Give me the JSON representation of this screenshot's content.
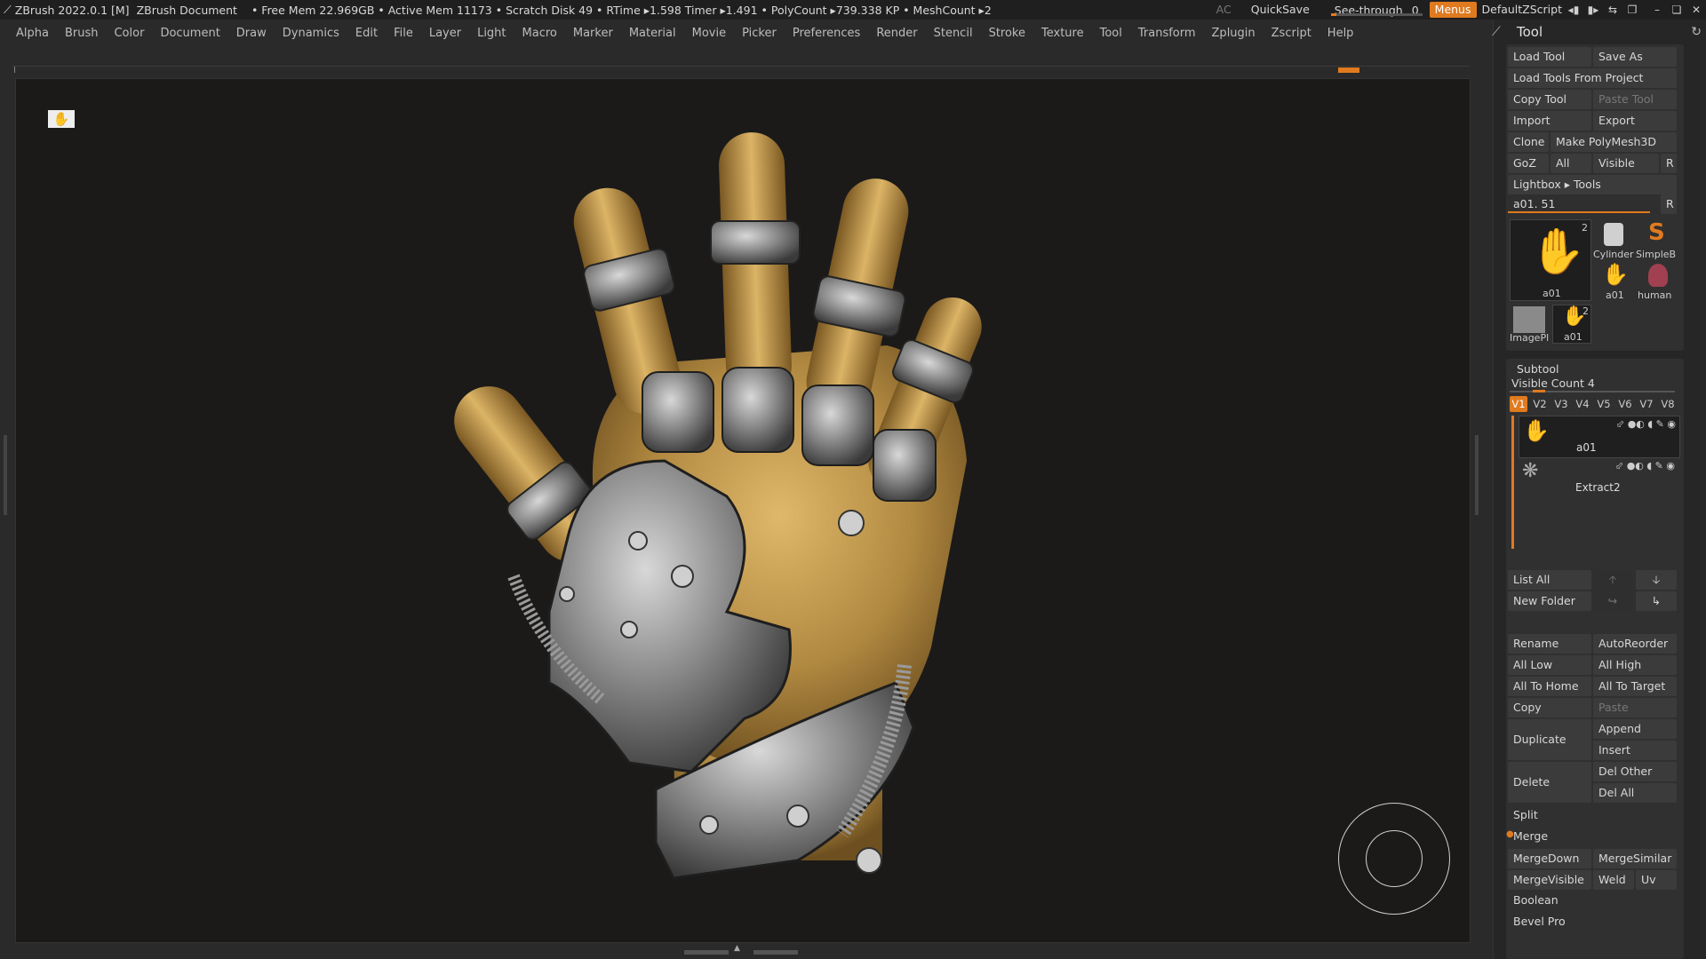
{
  "titlebar": {
    "app": "ZBrush 2022.0.1 [M]",
    "document": "ZBrush Document",
    "stats": "• Free Mem 22.969GB • Active Mem 11173 • Scratch Disk 49 • RTime ▸1.598 Timer ▸1.491 • PolyCount ▸739.338 KP • MeshCount ▸2",
    "ac": "AC",
    "quicksave": "QuickSave",
    "seethrough": "See-through",
    "seethrough_value": "0",
    "seethrough_fraction": 0,
    "menus": "Menus",
    "script": "DefaultZScript"
  },
  "menubar": [
    "Alpha",
    "Brush",
    "Color",
    "Document",
    "Draw",
    "Dynamics",
    "Edit",
    "File",
    "Layer",
    "Light",
    "Macro",
    "Marker",
    "Material",
    "Movie",
    "Picker",
    "Preferences",
    "Render",
    "Stencil",
    "Stroke",
    "Texture",
    "Tool",
    "Transform",
    "Zplugin",
    "Zscript",
    "Help"
  ],
  "panel": {
    "title": "Tool",
    "load_tool": "Load Tool",
    "save_as": "Save As",
    "load_from_project": "Load Tools From Project",
    "copy_tool": "Copy Tool",
    "paste_tool": "Paste Tool",
    "import": "Import",
    "export": "Export",
    "clone": "Clone",
    "make_polymesh": "Make PolyMesh3D",
    "goz": "GoZ",
    "all": "All",
    "visible": "Visible",
    "r": "R",
    "lightbox_tools": "Lightbox ▸ Tools",
    "current_tool": "a01. 51",
    "thumbs": {
      "main": "a01",
      "main_count": "2",
      "cylinder": "Cylinder",
      "simpleb": "SimpleB",
      "a01_small": "a01",
      "human": "human",
      "imageplane": "ImagePl",
      "a01_last": "a01",
      "a01_last_count": "2"
    }
  },
  "subtool": {
    "title": "Subtool",
    "visible_count": "Visible Count 4",
    "versions": [
      "V1",
      "V2",
      "V3",
      "V4",
      "V5",
      "V6",
      "V7",
      "V8"
    ],
    "items": [
      "a01",
      "Extract2"
    ],
    "list_all": "List All",
    "new_folder": "New Folder",
    "rename": "Rename",
    "autoreorder": "AutoReorder",
    "all_low": "All Low",
    "all_high": "All High",
    "all_to_home": "All To Home",
    "all_to_target": "All To Target",
    "copy": "Copy",
    "paste": "Paste",
    "duplicate": "Duplicate",
    "append": "Append",
    "insert": "Insert",
    "delete": "Delete",
    "del_other": "Del Other",
    "del_all": "Del All",
    "split": "Split",
    "merge": "Merge",
    "mergedown": "MergeDown",
    "mergesimilar": "MergeSimilar",
    "mergevisible": "MergeVisible",
    "weld": "Weld",
    "uv": "Uv",
    "boolean": "Boolean",
    "bevel_pro": "Bevel Pro"
  },
  "colors": {
    "accent": "#e07a1f",
    "viewport_bg": "#1b1a19",
    "panel_bg": "#262626"
  },
  "icons": [
    "zbrush-logo-icon",
    "hand-tool-icon",
    "gyro-icon",
    "refresh-icon",
    "eye-icon",
    "brush-icon",
    "arrow-up-icon",
    "arrow-down-icon"
  ]
}
